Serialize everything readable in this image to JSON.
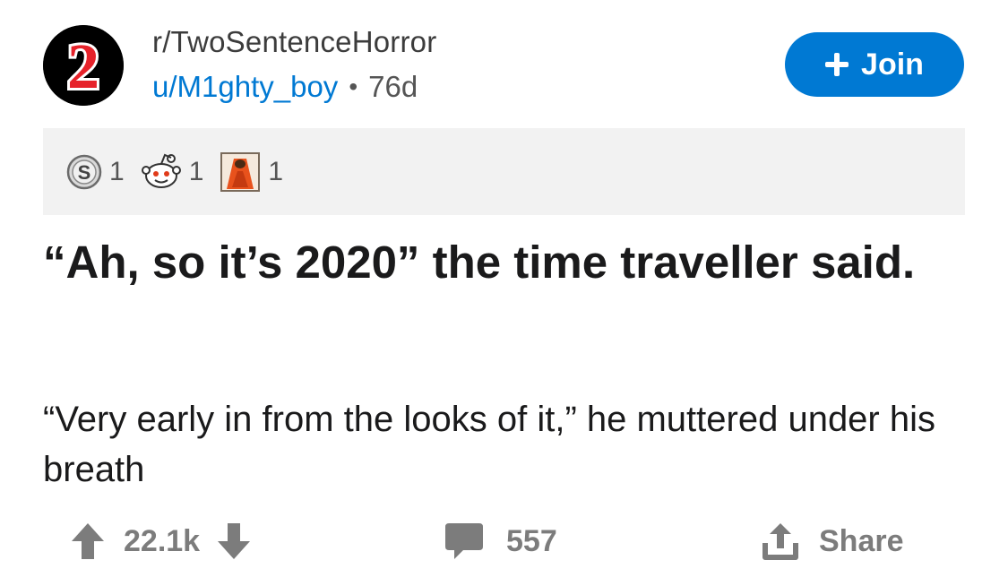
{
  "header": {
    "avatar_text": "2",
    "subreddit": "r/TwoSentenceHorror",
    "user": "u/M1ghty_boy",
    "separator": "•",
    "age": "76d",
    "join_label": "Join",
    "join_icon": "plus-icon"
  },
  "awards": [
    {
      "icon": "silver-award-icon",
      "count": "1"
    },
    {
      "icon": "wholesome-award-icon",
      "count": "1"
    },
    {
      "icon": "shocked-award-icon",
      "count": "1"
    }
  ],
  "post": {
    "title": "“Ah, so it’s 2020” the time traveller said.",
    "body": "“Very early in from the looks of it,” he muttered under his breath"
  },
  "actions": {
    "score": "22.1k",
    "comments": "557",
    "share_label": "Share"
  },
  "colors": {
    "accent": "#0079d3",
    "avatar_bg": "#000000",
    "avatar_text": "#e6222a",
    "awards_bg": "#f2f2f2",
    "action_gray": "#7c7c7c"
  }
}
